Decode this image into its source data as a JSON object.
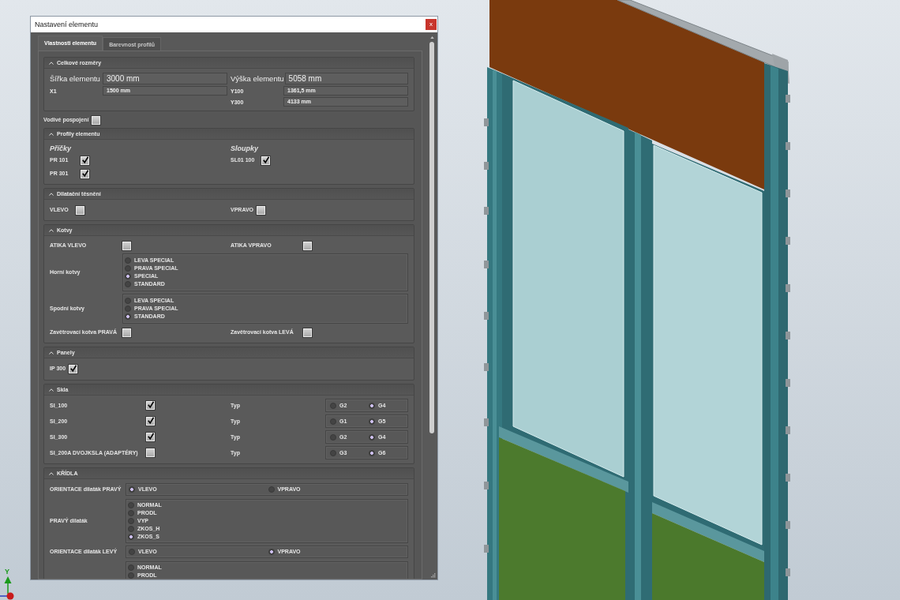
{
  "window": {
    "title": "Nastavení elementu",
    "close": "x"
  },
  "tabs": [
    {
      "label": "Vlastnosti elementu",
      "selected": true
    },
    {
      "label": "Barevnost profilů",
      "selected": false
    }
  ],
  "dimensions": {
    "title": "Celkové rozměry",
    "expanded": true,
    "rows": [
      {
        "kind": "large",
        "left": {
          "label": "Šířka elementu",
          "value": "3000 mm"
        },
        "right": {
          "label": "Výška elementu",
          "value": "5058 mm"
        }
      },
      {
        "kind": "small",
        "left": {
          "label": "X1",
          "value": "1500 mm"
        },
        "right": {
          "label": "Y100",
          "value": "1361,5 mm"
        }
      },
      {
        "kind": "small",
        "right": {
          "label": "Y300",
          "value": "4133 mm"
        }
      }
    ]
  },
  "conductive_bonding": {
    "label": "Vodivé pospojení",
    "checked": false
  },
  "profiles": {
    "title": "Profily elementu",
    "expanded": true,
    "groups": [
      {
        "heading": "Příčky",
        "items": [
          {
            "label": "PR 101",
            "checked": true
          },
          {
            "label": "PR 301",
            "checked": true
          }
        ]
      },
      {
        "heading": "Sloupky",
        "items": [
          {
            "label": "SL01 100",
            "checked": true
          }
        ]
      }
    ]
  },
  "expansion_seal": {
    "title": "Dilatační těsnění",
    "expanded": true,
    "items": [
      {
        "label": "VLEVO",
        "checked": false
      },
      {
        "label": "VPRAVO",
        "checked": false
      }
    ]
  },
  "anchors": {
    "title": "Kotvy",
    "expanded": true,
    "rows": [
      {
        "kind": "checks",
        "items": [
          {
            "label": "ATIKA VLEVO",
            "checked": false
          },
          {
            "label": "ATIKA VPRAVO",
            "checked": false
          }
        ]
      },
      {
        "kind": "stack",
        "label": "Horní kotvy",
        "options": [
          {
            "label": "LEVA SPECIAL",
            "selected": false
          },
          {
            "label": "PRAVA SPECIAL",
            "selected": false
          },
          {
            "label": "SPECIAL",
            "selected": true
          },
          {
            "label": "STANDARD",
            "selected": false
          }
        ]
      },
      {
        "kind": "stack",
        "label": "Spodní kotvy",
        "options": [
          {
            "label": "LEVA SPECIAL",
            "selected": false
          },
          {
            "label": "PRAVA SPECIAL",
            "selected": false
          },
          {
            "label": "STANDARD",
            "selected": true
          }
        ]
      },
      {
        "kind": "checks",
        "items": [
          {
            "label": "Zavětrovací kotva PRAVÁ",
            "checked": false
          },
          {
            "label": "Zavětrovací kotva LEVÁ",
            "checked": false
          }
        ]
      }
    ]
  },
  "panels": {
    "title": "Panely",
    "expanded": true,
    "items": [
      {
        "label": "IP 300",
        "checked": true
      }
    ]
  },
  "glass": {
    "title": "Skla",
    "expanded": true,
    "rows": [
      {
        "label": "SI_100",
        "checked": true,
        "type_label": "Typ",
        "options": [
          {
            "label": "G2",
            "selected": false
          },
          {
            "label": "G4",
            "selected": true
          }
        ]
      },
      {
        "label": "SI_200",
        "checked": true,
        "type_label": "Typ",
        "options": [
          {
            "label": "G1",
            "selected": false
          },
          {
            "label": "G5",
            "selected": true
          }
        ]
      },
      {
        "label": "SI_300",
        "checked": true,
        "type_label": "Typ",
        "options": [
          {
            "label": "G2",
            "selected": false
          },
          {
            "label": "G4",
            "selected": true
          }
        ]
      },
      {
        "label": "SI_200A DVOJKSLA (ADAPTÉRY)",
        "checked": false,
        "type_label": "Typ",
        "options": [
          {
            "label": "G3",
            "selected": false
          },
          {
            "label": "G6",
            "selected": true
          }
        ]
      }
    ]
  },
  "sashes": {
    "title": "KŘÍDLA",
    "expanded": true,
    "rows": [
      {
        "kind": "inline",
        "label": "ORIENTACE dilaták PRAVÝ",
        "options": [
          {
            "label": "VLEVO",
            "selected": true
          },
          {
            "label": "VPRAVO",
            "selected": false
          }
        ]
      },
      {
        "kind": "stack",
        "label": "PRAVÝ dilaták",
        "options": [
          {
            "label": "NORMAL",
            "selected": false
          },
          {
            "label": "PRODL",
            "selected": false
          },
          {
            "label": "VYP",
            "selected": false
          },
          {
            "label": "ZKOS_H",
            "selected": false
          },
          {
            "label": "ZKOS_S",
            "selected": true
          }
        ]
      },
      {
        "kind": "inline",
        "label": "ORIENTACE dilaták LEVÝ",
        "options": [
          {
            "label": "VLEVO",
            "selected": false
          },
          {
            "label": "VPRAVO",
            "selected": true
          }
        ]
      },
      {
        "kind": "stack",
        "options": [
          {
            "label": "NORMAL",
            "selected": false
          },
          {
            "label": "PRODL",
            "selected": false
          }
        ]
      }
    ]
  },
  "viewport": {
    "axis_label": "Y"
  }
}
